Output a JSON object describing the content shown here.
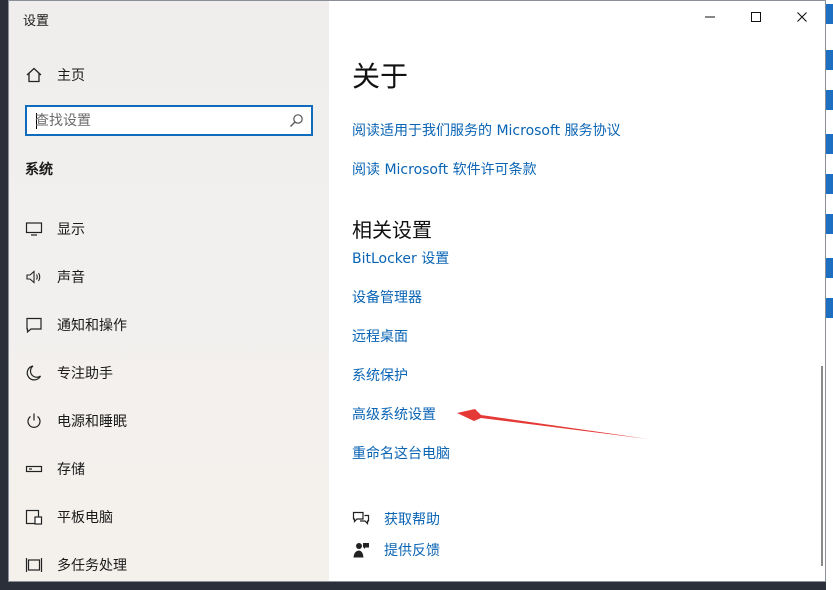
{
  "window": {
    "title": "设置"
  },
  "sidebar": {
    "home_label": "主页",
    "search_placeholder": "查找设置",
    "section": "系统",
    "items": [
      {
        "label": "显示",
        "icon": "display-icon"
      },
      {
        "label": "声音",
        "icon": "speaker-icon"
      },
      {
        "label": "通知和操作",
        "icon": "notification-icon"
      },
      {
        "label": "专注助手",
        "icon": "moon-icon"
      },
      {
        "label": "电源和睡眠",
        "icon": "power-icon"
      },
      {
        "label": "存储",
        "icon": "storage-icon"
      },
      {
        "label": "平板电脑",
        "icon": "tablet-icon"
      },
      {
        "label": "多任务处理",
        "icon": "multitask-icon"
      }
    ]
  },
  "main": {
    "title": "关于",
    "links_top": [
      "阅读适用于我们服务的 Microsoft 服务协议",
      "阅读 Microsoft 软件许可条款"
    ],
    "related_title": "相关设置",
    "related_links": [
      "BitLocker 设置",
      "设备管理器",
      "远程桌面",
      "系统保护",
      "高级系统设置",
      "重命名这台电脑"
    ],
    "help": [
      {
        "label": "获取帮助",
        "icon": "help-chat-icon"
      },
      {
        "label": "提供反馈",
        "icon": "feedback-icon"
      }
    ]
  },
  "annotation": {
    "color": "#e53935",
    "target": "高级系统设置"
  },
  "colors": {
    "accent": "#0f6cbd",
    "link": "#0a64b4"
  }
}
